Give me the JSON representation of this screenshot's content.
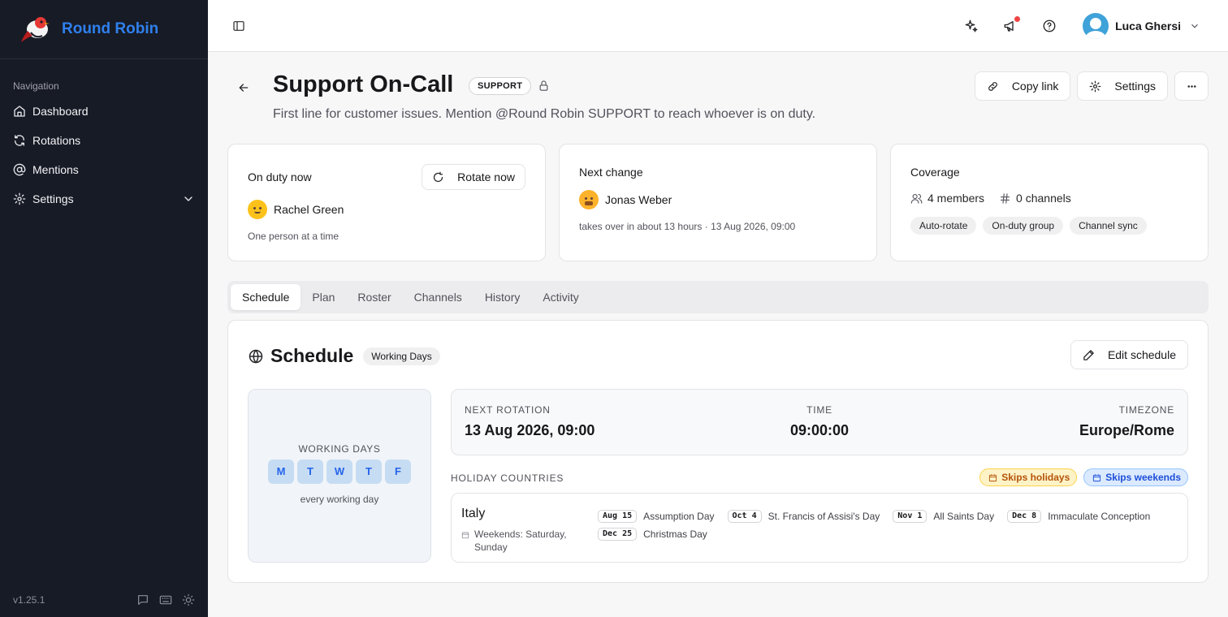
{
  "brand": {
    "name": "Round Robin"
  },
  "sidebar": {
    "nav_title": "Navigation",
    "items": [
      {
        "label": "Dashboard",
        "icon": "home-icon"
      },
      {
        "label": "Rotations",
        "icon": "refresh-icon"
      },
      {
        "label": "Mentions",
        "icon": "at-icon"
      },
      {
        "label": "Settings",
        "icon": "gear-icon"
      }
    ],
    "version": "v1.25.1"
  },
  "topbar": {
    "user_name": "Luca Ghersi"
  },
  "page": {
    "title": "Support On-Call",
    "badge": "SUPPORT",
    "subtitle": "First line for customer issues. Mention @Round Robin SUPPORT to reach whoever is on duty.",
    "actions": {
      "copy_link": "Copy link",
      "settings": "Settings"
    }
  },
  "cards": {
    "on_duty": {
      "label": "On duty now",
      "rotate_label": "Rotate now",
      "person": "Rachel Green",
      "note": "One person at a time"
    },
    "next_change": {
      "label": "Next change",
      "person": "Jonas Weber",
      "note": "takes over in about 13 hours · 13 Aug 2026, 09:00"
    },
    "coverage": {
      "label": "Coverage",
      "members": "4 members",
      "channels": "0 channels",
      "chips": [
        "Auto-rotate",
        "On-duty group",
        "Channel sync"
      ]
    }
  },
  "tabs": [
    {
      "label": "Schedule",
      "active": true
    },
    {
      "label": "Plan",
      "active": false
    },
    {
      "label": "Roster",
      "active": false
    },
    {
      "label": "Channels",
      "active": false
    },
    {
      "label": "History",
      "active": false
    },
    {
      "label": "Activity",
      "active": false
    }
  ],
  "schedule": {
    "title": "Schedule",
    "badge": "Working Days",
    "edit_label": "Edit schedule",
    "working_days_label": "WORKING DAYS",
    "days": [
      "M",
      "T",
      "W",
      "T",
      "F"
    ],
    "working_days_note": "every working day",
    "next_rotation_label": "NEXT ROTATION",
    "next_rotation_value": "13 Aug 2026, 09:00",
    "time_label": "TIME",
    "time_value": "09:00:00",
    "timezone_label": "TIMEZONE",
    "timezone_value": "Europe/Rome",
    "holiday_label": "HOLIDAY COUNTRIES",
    "skips_holidays": "Skips holidays",
    "skips_weekends": "Skips weekends",
    "country": {
      "name": "Italy",
      "weekends": "Weekends: Saturday, Sunday",
      "holidays": [
        {
          "date": "Aug 15",
          "name": "Assumption Day"
        },
        {
          "date": "Oct 4",
          "name": "St. Francis of Assisi's Day"
        },
        {
          "date": "Nov 1",
          "name": "All Saints Day"
        },
        {
          "date": "Dec 8",
          "name": "Immaculate Conception"
        },
        {
          "date": "Dec 25",
          "name": "Christmas Day"
        }
      ]
    }
  },
  "colors": {
    "brand": "#2f80ed",
    "sidebar_bg": "#171b26",
    "day_chip": "#c6dcf2",
    "notification_dot": "#ef4444"
  }
}
